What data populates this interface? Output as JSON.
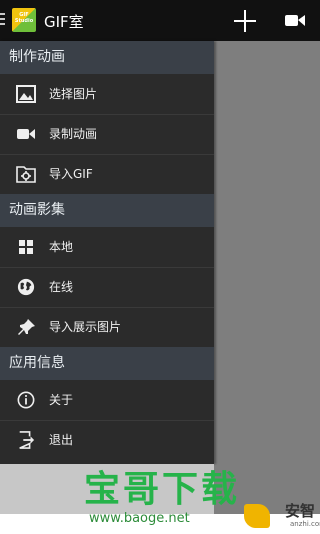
{
  "app": {
    "title": "GIF室",
    "logo_text": "GIF Studio"
  },
  "drawer": {
    "sections": [
      {
        "header": "制作动画",
        "items": [
          "选择图片",
          "录制动画",
          "导入GIF"
        ]
      },
      {
        "header": "动画影集",
        "items": [
          "本地",
          "在线",
          "导入展示图片"
        ]
      },
      {
        "header": "应用信息",
        "items": [
          "关于",
          "退出"
        ]
      }
    ]
  },
  "footer": {
    "brand": "宝哥下载",
    "url": "www.baoge.net",
    "badge_cn": "安智",
    "badge_en": "anzhi.com"
  },
  "icons": {
    "appbar": [
      "menu-icon",
      "app-logo-icon",
      "add-icon",
      "video-camera-icon"
    ],
    "items": [
      "image-icon",
      "video-camera-icon",
      "import-folder-icon",
      "grid-icon",
      "globe-icon",
      "pin-icon",
      "info-icon",
      "exit-icon"
    ]
  }
}
